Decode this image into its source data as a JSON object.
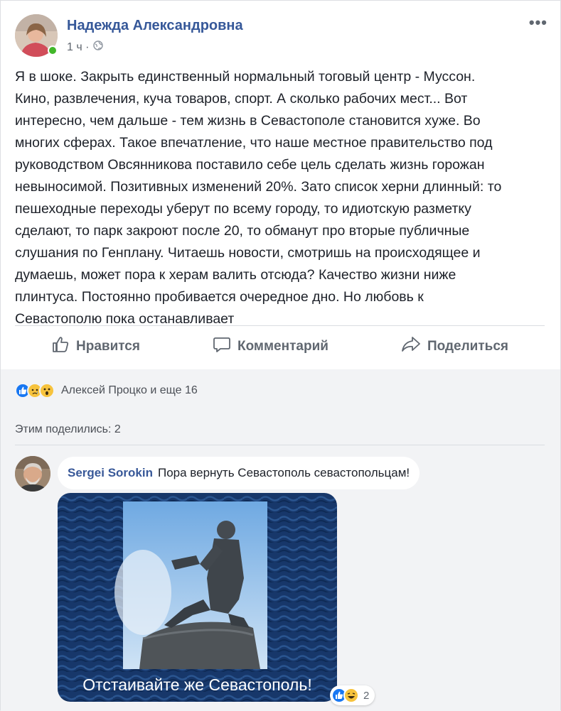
{
  "post": {
    "author": "Надежда Александровна",
    "time": "1 ч ·",
    "privacy_icon": "globe-icon",
    "more_icon": "more-icon",
    "text_lines": [
      "Я в шоке. Закрыть единственный нормальный тоговый центр - Муссон.",
      "Кино, развлечения, куча товаров, спорт. А сколько рабочих мест... Вот",
      "интересно, чем дальше - тем жизнь в Севастополе становится хуже. Во",
      "многих сферах. Такое впечатление, что наше местное правительство под",
      "руководством Овсянникова поставило себе цель сделать жизнь горожан",
      "невыносимой. Позитивных изменений 20%. Зато список херни длинный: то",
      "пешеходные переходы уберут по всему городу, то идиотскую разметку",
      "сделают, то парк закроют после 20, то обманут про вторые публичные",
      "слушания по Генплану. Читаешь новости, смотришь на происходящее и",
      "думаешь, может пора к херам валить отсюда? Качество жизни ниже",
      "плинтуса. Постоянно пробивается очередное дно. Но любовь к",
      "Севастополю пока останавливает"
    ]
  },
  "actions": {
    "like": "Нравится",
    "comment": "Комментарий",
    "share": "Поделиться"
  },
  "reactions": {
    "icons": [
      "like-icon",
      "sad-icon",
      "wow-icon"
    ],
    "summary": "Алексей Процко и еще 16"
  },
  "shares": {
    "label": "Этим поделились: 2"
  },
  "comment": {
    "author": "Sergei Sorokin",
    "text": "Пора вернуть Севастополь севастопольцам!",
    "image_caption": "Отстаивайте же Севастополь!",
    "reaction_icons": [
      "like-icon",
      "haha-icon"
    ],
    "reaction_count": "2"
  },
  "colors": {
    "link_blue": "#365899",
    "like_blue": "#1877f2",
    "online_green": "#42b72a",
    "emoji_yellow": "#f7c33d"
  }
}
